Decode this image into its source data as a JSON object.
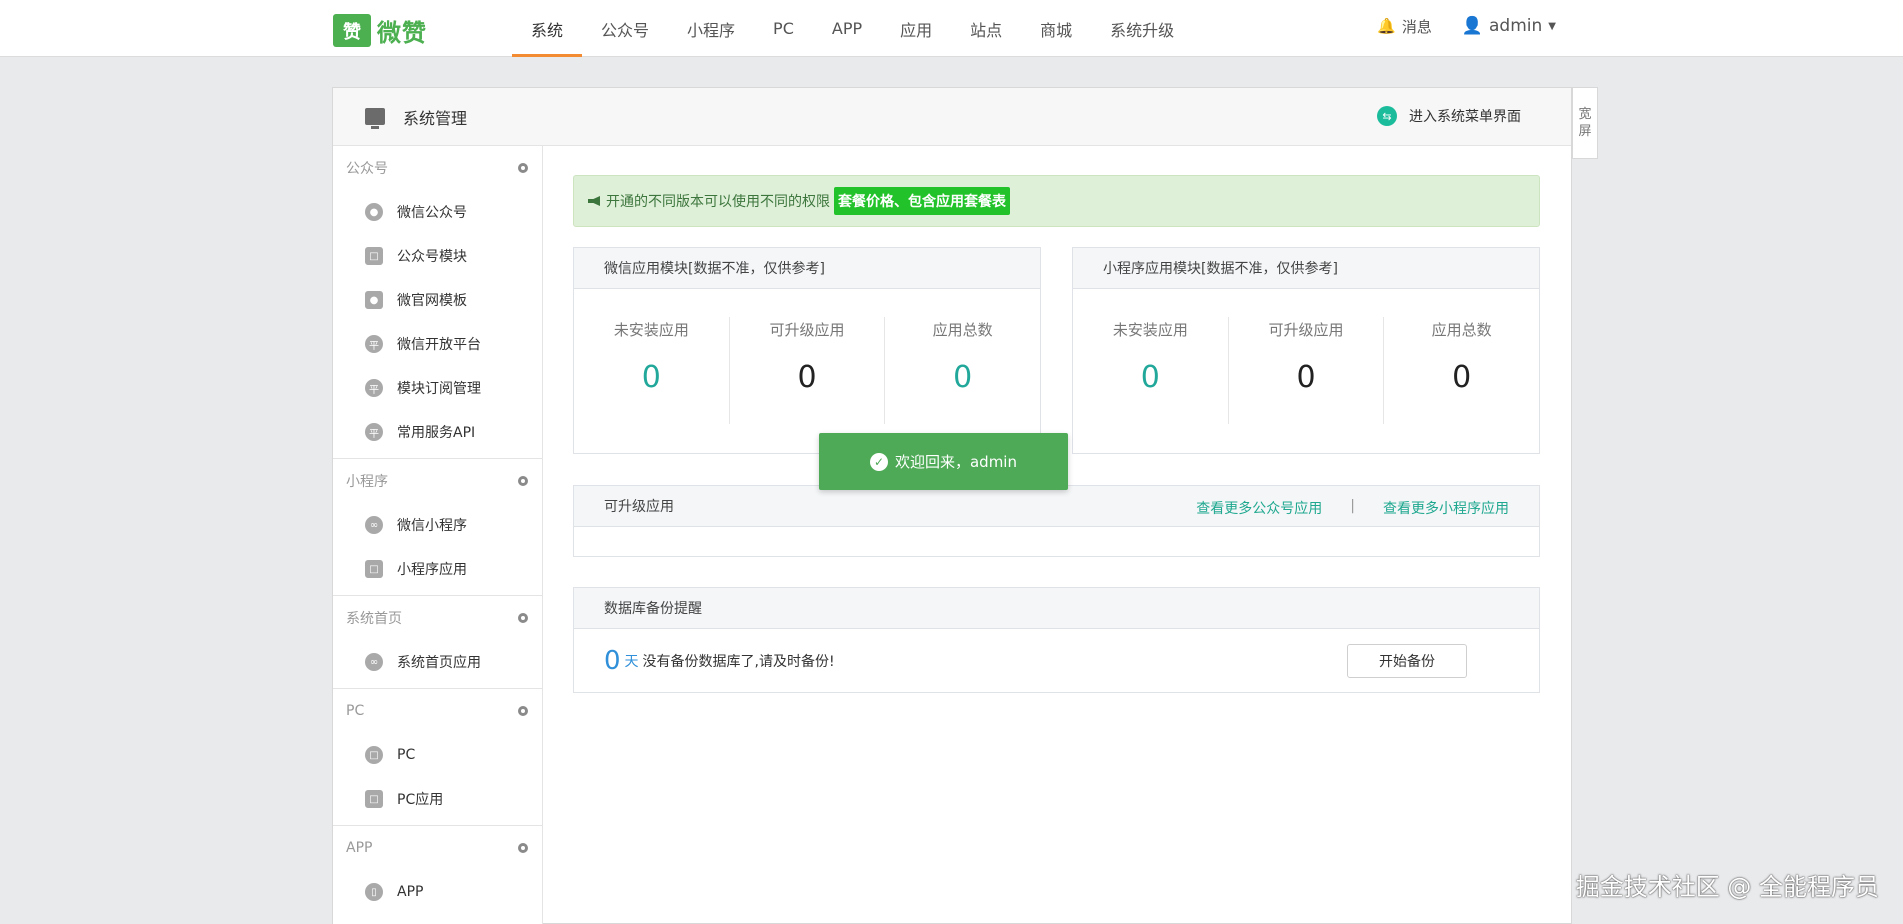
{
  "logo": {
    "box": "赞",
    "text": "微赞"
  },
  "nav": [
    "系统",
    "公众号",
    "小程序",
    "PC",
    "APP",
    "应用",
    "站点",
    "商城",
    "系统升级"
  ],
  "top_right": {
    "messages": "消息",
    "user": "admin"
  },
  "panel": {
    "title": "系统管理",
    "enter": "进入系统菜单界面",
    "wide": [
      "宽",
      "屏"
    ]
  },
  "sidebar": {
    "groups": [
      {
        "title": "公众号",
        "items": [
          "微信公众号",
          "公众号模块",
          "微官网模板",
          "微信开放平台",
          "模块订阅管理",
          "常用服务API"
        ]
      },
      {
        "title": "小程序",
        "items": [
          "微信小程序",
          "小程序应用"
        ]
      },
      {
        "title": "系统首页",
        "items": [
          "系统首页应用"
        ]
      },
      {
        "title": "PC",
        "items": [
          "PC",
          "PC应用"
        ]
      },
      {
        "title": "APP",
        "items": [
          "APP"
        ]
      }
    ]
  },
  "notice": {
    "text": "开通的不同版本可以使用不同的权限",
    "link": "套餐价格、包含应用套餐表"
  },
  "wechat_card": {
    "title": "微信应用模块[数据不准，仅供参考]",
    "stats": [
      {
        "label": "未安装应用",
        "value": "0"
      },
      {
        "label": "可升级应用",
        "value": "0"
      },
      {
        "label": "应用总数",
        "value": "0"
      }
    ]
  },
  "mini_card": {
    "title": "小程序应用模块[数据不准，仅供参考]",
    "stats": [
      {
        "label": "未安装应用",
        "value": "0"
      },
      {
        "label": "可升级应用",
        "value": "0"
      },
      {
        "label": "应用总数",
        "value": "0"
      }
    ]
  },
  "upgrade_card": {
    "title": "可升级应用",
    "link1": "查看更多公众号应用",
    "sep": "|",
    "link2": "查看更多小程序应用"
  },
  "backup_card": {
    "title": "数据库备份提醒",
    "days": "0",
    "unit": "天",
    "text": "没有备份数据库了,请及时备份!",
    "button": "开始备份"
  },
  "toast": {
    "text": "欢迎回来，admin"
  },
  "watermark": "掘金技术社区 @ 全能程序员",
  "colors": {
    "accent": "#f28b32",
    "brand_green": "#4caf50",
    "teal": "#22a89a",
    "notice_bg": "#dff0d8"
  }
}
